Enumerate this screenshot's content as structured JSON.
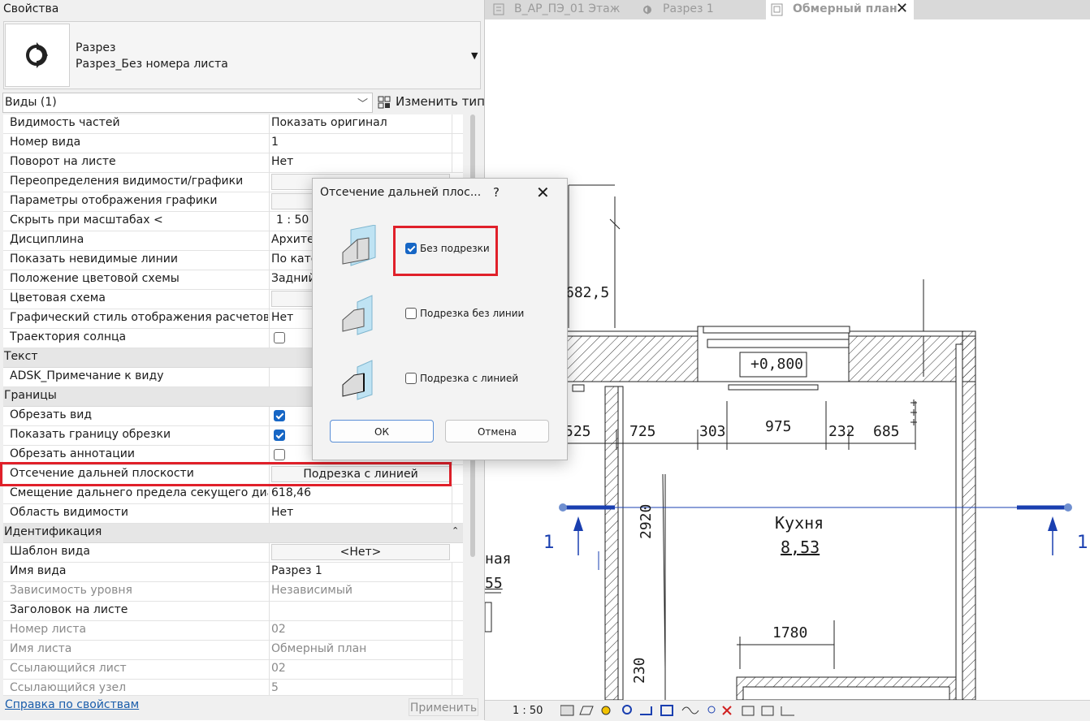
{
  "properties": {
    "title": "Свойства",
    "type_name_line1": "Разрез",
    "type_name_line2": "Разрез_Без номера листа",
    "views_selector": "Виды (1)",
    "edit_type": "Изменить тип",
    "rows": {
      "r0": {
        "name": "Видимость частей",
        "value": "Показать оригинал"
      },
      "r1": {
        "name": "Номер вида",
        "value": "1"
      },
      "r2": {
        "name": "Поворот на листе",
        "value": "Нет"
      },
      "r3": {
        "name": "Переопределения видимости/графики",
        "value": ""
      },
      "r4": {
        "name": "Параметры отображения графики",
        "value": ""
      },
      "r5": {
        "name": "Скрыть при масштабах <",
        "value": "1 : 50"
      },
      "r6": {
        "name": "Дисциплина",
        "value": "Архите"
      },
      "r7": {
        "name": "Показать невидимые линии",
        "value": "По кате"
      },
      "r8": {
        "name": "Положение цветовой схемы",
        "value": "Задний"
      },
      "r9": {
        "name": "Цветовая схема",
        "value": ""
      },
      "r10": {
        "name": "Графический стиль отображения расчетов ...",
        "value": "Нет"
      },
      "r11": {
        "name": "Траектория солнца",
        "checked": false
      },
      "cat_text": "Текст",
      "r12": {
        "name": "ADSK_Примечание к виду",
        "value": ""
      },
      "cat_bounds": "Границы",
      "r13": {
        "name": "Обрезать вид",
        "checked": true
      },
      "r14": {
        "name": "Показать границу обрезки",
        "checked": true
      },
      "r15": {
        "name": "Обрезать аннотации",
        "checked": false
      },
      "r16": {
        "name": "Отсечение дальней плоскости",
        "value": "Подрезка с линией"
      },
      "r17": {
        "name": "Смещение дальнего предела секущего диа...",
        "value": "618,46"
      },
      "r18": {
        "name": "Область видимости",
        "value": "Нет"
      },
      "cat_ident": "Идентификация",
      "r19": {
        "name": "Шаблон вида",
        "value": "<Нет>"
      },
      "r20": {
        "name": "Имя вида",
        "value": "Разрез 1"
      },
      "r21": {
        "name": "Зависимость уровня",
        "value": "Независимый"
      },
      "r22": {
        "name": "Заголовок на листе",
        "value": ""
      },
      "r23": {
        "name": "Номер листа",
        "value": "02"
      },
      "r24": {
        "name": "Имя листа",
        "value": "Обмерный план"
      },
      "r25": {
        "name": "Ссылающийся лист",
        "value": "02"
      },
      "r26": {
        "name": "Ссылающийся узел",
        "value": "5"
      }
    },
    "help_link": "Справка по свойствам",
    "apply": "Применить"
  },
  "tabs": {
    "t1": "В_АР_ПЭ_01 Этаж",
    "t2": "Разрез 1",
    "t3": "Обмерный план"
  },
  "drawing": {
    "dims": {
      "d0": "682,5",
      "d1": "525",
      "d2": "725",
      "d3": "303",
      "d4": "975",
      "d5": "232",
      "d6": "685",
      "d7": "2920",
      "d8": "1780",
      "d9": "230"
    },
    "level_tag": "+0,800",
    "room_name": "Кухня",
    "room_area": "8,53",
    "left_room_name": "ная",
    "left_room_area": "55",
    "section_mark": "1",
    "scale": "1 : 50"
  },
  "dialog": {
    "title": "Отсечение дальней плос...",
    "help": "?",
    "option1": "Без подрезки",
    "option2": "Подрезка без линии",
    "option3": "Подрезка с линией",
    "option1_checked": true,
    "option2_checked": false,
    "option3_checked": false,
    "ok": "ОК",
    "cancel": "Отмена"
  },
  "colors": {
    "highlight": "#e0202a",
    "accent": "#1666c5",
    "section_line": "#1a3fb0"
  }
}
